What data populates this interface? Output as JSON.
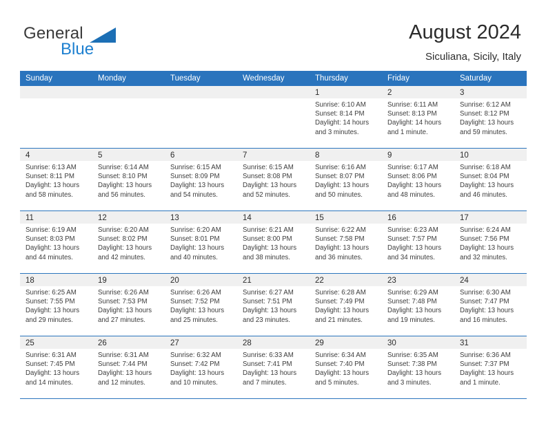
{
  "brand": {
    "name_part1": "General",
    "name_part2": "Blue",
    "triangle_icon": "triangle-icon",
    "accent_color": "#1c7fd0"
  },
  "header": {
    "title": "August 2024",
    "subtitle": "Siculiana, Sicily, Italy"
  },
  "theme": {
    "header_blue": "#2a74bd",
    "day_band_gray": "#f0f0f0",
    "text_color": "#3c3c3c"
  },
  "weekdays": [
    "Sunday",
    "Monday",
    "Tuesday",
    "Wednesday",
    "Thursday",
    "Friday",
    "Saturday"
  ],
  "labels": {
    "sunrise_prefix": "Sunrise:",
    "sunset_prefix": "Sunset:",
    "daylight_prefix": "Daylight:"
  },
  "weeks": [
    [
      {
        "day": "",
        "empty": true
      },
      {
        "day": "",
        "empty": true
      },
      {
        "day": "",
        "empty": true
      },
      {
        "day": "",
        "empty": true
      },
      {
        "day": "1",
        "sunrise": "Sunrise: 6:10 AM",
        "sunset": "Sunset: 8:14 PM",
        "daylight_line1": "Daylight: 14 hours",
        "daylight_line2": "and 3 minutes."
      },
      {
        "day": "2",
        "sunrise": "Sunrise: 6:11 AM",
        "sunset": "Sunset: 8:13 PM",
        "daylight_line1": "Daylight: 14 hours",
        "daylight_line2": "and 1 minute."
      },
      {
        "day": "3",
        "sunrise": "Sunrise: 6:12 AM",
        "sunset": "Sunset: 8:12 PM",
        "daylight_line1": "Daylight: 13 hours",
        "daylight_line2": "and 59 minutes."
      }
    ],
    [
      {
        "day": "4",
        "sunrise": "Sunrise: 6:13 AM",
        "sunset": "Sunset: 8:11 PM",
        "daylight_line1": "Daylight: 13 hours",
        "daylight_line2": "and 58 minutes."
      },
      {
        "day": "5",
        "sunrise": "Sunrise: 6:14 AM",
        "sunset": "Sunset: 8:10 PM",
        "daylight_line1": "Daylight: 13 hours",
        "daylight_line2": "and 56 minutes."
      },
      {
        "day": "6",
        "sunrise": "Sunrise: 6:15 AM",
        "sunset": "Sunset: 8:09 PM",
        "daylight_line1": "Daylight: 13 hours",
        "daylight_line2": "and 54 minutes."
      },
      {
        "day": "7",
        "sunrise": "Sunrise: 6:15 AM",
        "sunset": "Sunset: 8:08 PM",
        "daylight_line1": "Daylight: 13 hours",
        "daylight_line2": "and 52 minutes."
      },
      {
        "day": "8",
        "sunrise": "Sunrise: 6:16 AM",
        "sunset": "Sunset: 8:07 PM",
        "daylight_line1": "Daylight: 13 hours",
        "daylight_line2": "and 50 minutes."
      },
      {
        "day": "9",
        "sunrise": "Sunrise: 6:17 AM",
        "sunset": "Sunset: 8:06 PM",
        "daylight_line1": "Daylight: 13 hours",
        "daylight_line2": "and 48 minutes."
      },
      {
        "day": "10",
        "sunrise": "Sunrise: 6:18 AM",
        "sunset": "Sunset: 8:04 PM",
        "daylight_line1": "Daylight: 13 hours",
        "daylight_line2": "and 46 minutes."
      }
    ],
    [
      {
        "day": "11",
        "sunrise": "Sunrise: 6:19 AM",
        "sunset": "Sunset: 8:03 PM",
        "daylight_line1": "Daylight: 13 hours",
        "daylight_line2": "and 44 minutes."
      },
      {
        "day": "12",
        "sunrise": "Sunrise: 6:20 AM",
        "sunset": "Sunset: 8:02 PM",
        "daylight_line1": "Daylight: 13 hours",
        "daylight_line2": "and 42 minutes."
      },
      {
        "day": "13",
        "sunrise": "Sunrise: 6:20 AM",
        "sunset": "Sunset: 8:01 PM",
        "daylight_line1": "Daylight: 13 hours",
        "daylight_line2": "and 40 minutes."
      },
      {
        "day": "14",
        "sunrise": "Sunrise: 6:21 AM",
        "sunset": "Sunset: 8:00 PM",
        "daylight_line1": "Daylight: 13 hours",
        "daylight_line2": "and 38 minutes."
      },
      {
        "day": "15",
        "sunrise": "Sunrise: 6:22 AM",
        "sunset": "Sunset: 7:58 PM",
        "daylight_line1": "Daylight: 13 hours",
        "daylight_line2": "and 36 minutes."
      },
      {
        "day": "16",
        "sunrise": "Sunrise: 6:23 AM",
        "sunset": "Sunset: 7:57 PM",
        "daylight_line1": "Daylight: 13 hours",
        "daylight_line2": "and 34 minutes."
      },
      {
        "day": "17",
        "sunrise": "Sunrise: 6:24 AM",
        "sunset": "Sunset: 7:56 PM",
        "daylight_line1": "Daylight: 13 hours",
        "daylight_line2": "and 32 minutes."
      }
    ],
    [
      {
        "day": "18",
        "sunrise": "Sunrise: 6:25 AM",
        "sunset": "Sunset: 7:55 PM",
        "daylight_line1": "Daylight: 13 hours",
        "daylight_line2": "and 29 minutes."
      },
      {
        "day": "19",
        "sunrise": "Sunrise: 6:26 AM",
        "sunset": "Sunset: 7:53 PM",
        "daylight_line1": "Daylight: 13 hours",
        "daylight_line2": "and 27 minutes."
      },
      {
        "day": "20",
        "sunrise": "Sunrise: 6:26 AM",
        "sunset": "Sunset: 7:52 PM",
        "daylight_line1": "Daylight: 13 hours",
        "daylight_line2": "and 25 minutes."
      },
      {
        "day": "21",
        "sunrise": "Sunrise: 6:27 AM",
        "sunset": "Sunset: 7:51 PM",
        "daylight_line1": "Daylight: 13 hours",
        "daylight_line2": "and 23 minutes."
      },
      {
        "day": "22",
        "sunrise": "Sunrise: 6:28 AM",
        "sunset": "Sunset: 7:49 PM",
        "daylight_line1": "Daylight: 13 hours",
        "daylight_line2": "and 21 minutes."
      },
      {
        "day": "23",
        "sunrise": "Sunrise: 6:29 AM",
        "sunset": "Sunset: 7:48 PM",
        "daylight_line1": "Daylight: 13 hours",
        "daylight_line2": "and 19 minutes."
      },
      {
        "day": "24",
        "sunrise": "Sunrise: 6:30 AM",
        "sunset": "Sunset: 7:47 PM",
        "daylight_line1": "Daylight: 13 hours",
        "daylight_line2": "and 16 minutes."
      }
    ],
    [
      {
        "day": "25",
        "sunrise": "Sunrise: 6:31 AM",
        "sunset": "Sunset: 7:45 PM",
        "daylight_line1": "Daylight: 13 hours",
        "daylight_line2": "and 14 minutes."
      },
      {
        "day": "26",
        "sunrise": "Sunrise: 6:31 AM",
        "sunset": "Sunset: 7:44 PM",
        "daylight_line1": "Daylight: 13 hours",
        "daylight_line2": "and 12 minutes."
      },
      {
        "day": "27",
        "sunrise": "Sunrise: 6:32 AM",
        "sunset": "Sunset: 7:42 PM",
        "daylight_line1": "Daylight: 13 hours",
        "daylight_line2": "and 10 minutes."
      },
      {
        "day": "28",
        "sunrise": "Sunrise: 6:33 AM",
        "sunset": "Sunset: 7:41 PM",
        "daylight_line1": "Daylight: 13 hours",
        "daylight_line2": "and 7 minutes."
      },
      {
        "day": "29",
        "sunrise": "Sunrise: 6:34 AM",
        "sunset": "Sunset: 7:40 PM",
        "daylight_line1": "Daylight: 13 hours",
        "daylight_line2": "and 5 minutes."
      },
      {
        "day": "30",
        "sunrise": "Sunrise: 6:35 AM",
        "sunset": "Sunset: 7:38 PM",
        "daylight_line1": "Daylight: 13 hours",
        "daylight_line2": "and 3 minutes."
      },
      {
        "day": "31",
        "sunrise": "Sunrise: 6:36 AM",
        "sunset": "Sunset: 7:37 PM",
        "daylight_line1": "Daylight: 13 hours",
        "daylight_line2": "and 1 minute."
      }
    ]
  ]
}
